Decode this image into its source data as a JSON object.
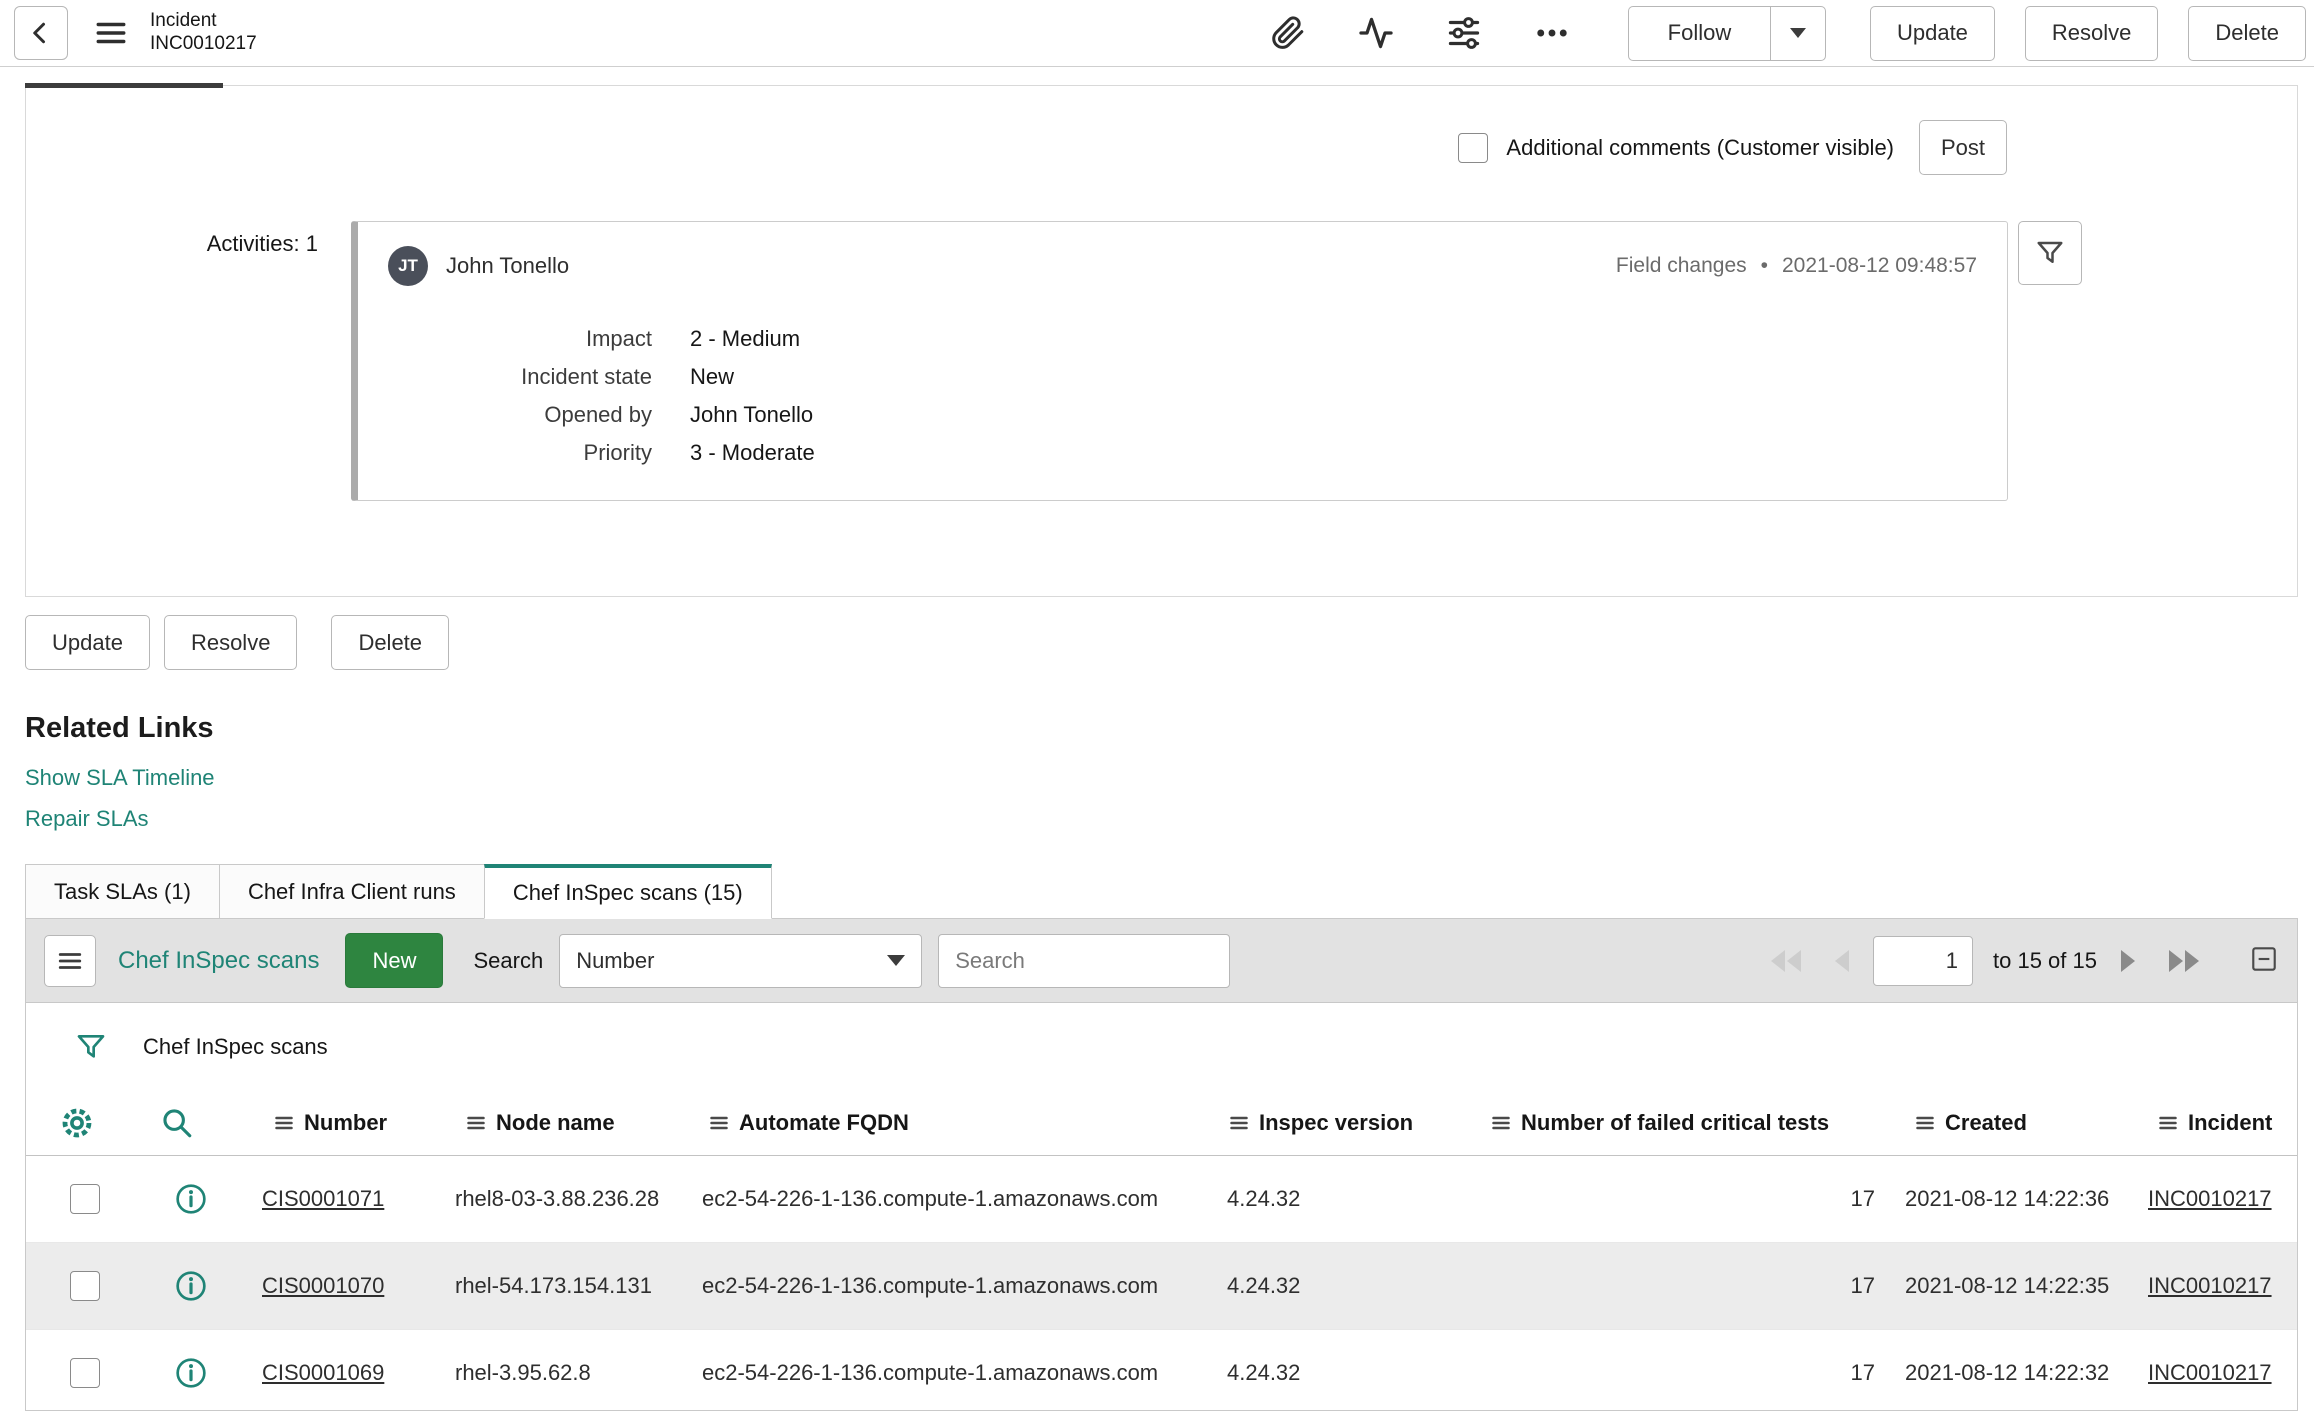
{
  "header": {
    "title_line1": "Incident",
    "title_line2": "INC0010217",
    "follow_label": "Follow",
    "update_label": "Update",
    "resolve_label": "Resolve",
    "delete_label": "Delete"
  },
  "comments": {
    "checkbox_label": "Additional comments (Customer visible)",
    "post_label": "Post"
  },
  "activity": {
    "section_label": "Activities: 1",
    "avatar_initials": "JT",
    "author": "John Tonello",
    "event_type": "Field changes",
    "separator": "•",
    "timestamp": "2021-08-12 09:48:57",
    "fields": [
      {
        "label": "Impact",
        "value": "2 - Medium"
      },
      {
        "label": "Incident state",
        "value": "New"
      },
      {
        "label": "Opened by",
        "value": "John Tonello"
      },
      {
        "label": "Priority",
        "value": "3 - Moderate"
      }
    ]
  },
  "form_actions": [
    "Update",
    "Resolve",
    "Delete"
  ],
  "related_links": {
    "title": "Related Links",
    "links": [
      "Show SLA Timeline",
      "Repair SLAs"
    ]
  },
  "tabs": [
    {
      "label": "Task SLAs (1)",
      "active": false
    },
    {
      "label": "Chef Infra Client runs",
      "active": false
    },
    {
      "label": "Chef InSpec scans (15)",
      "active": true
    }
  ],
  "list": {
    "title": "Chef InSpec scans",
    "new_label": "New",
    "search_label": "Search",
    "search_column": "Number",
    "search_placeholder": "Search",
    "page_value": "1",
    "page_range": "to 15 of 15",
    "breadcrumb": "Chef InSpec scans",
    "columns": [
      "Number",
      "Node name",
      "Automate FQDN",
      "Inspec version",
      "Number of failed critical tests",
      "Created",
      "Incident"
    ],
    "rows": [
      {
        "number": "CIS0001071",
        "node_name": "rhel8-03-3.88.236.28",
        "fqdn": "ec2-54-226-1-136.compute-1.amazonaws.com",
        "inspec_version": "4.24.32",
        "failed_tests": "17",
        "created": "2021-08-12 14:22:36",
        "incident": "INC0010217"
      },
      {
        "number": "CIS0001070",
        "node_name": "rhel-54.173.154.131",
        "fqdn": "ec2-54-226-1-136.compute-1.amazonaws.com",
        "inspec_version": "4.24.32",
        "failed_tests": "17",
        "created": "2021-08-12 14:22:35",
        "incident": "INC0010217"
      },
      {
        "number": "CIS0001069",
        "node_name": "rhel-3.95.62.8",
        "fqdn": "ec2-54-226-1-136.compute-1.amazonaws.com",
        "inspec_version": "4.24.32",
        "failed_tests": "17",
        "created": "2021-08-12 14:22:32",
        "incident": "INC0010217"
      }
    ]
  },
  "colors": {
    "teal_accent": "#1f8476",
    "green_button": "#2e8540",
    "toolbar_bg": "#e2e2e2",
    "row_alt_bg": "#ececec",
    "tab_active_border": "#1f8476"
  },
  "icons": {
    "back-icon": "chevron-left",
    "menu-icon": "hamburger",
    "attachment-icon": "paperclip",
    "activity-stream-icon": "pulse",
    "personalize-icon": "sliders",
    "more-options-icon": "ellipsis",
    "caret-down-icon": "triangle-down",
    "filter-icon": "funnel",
    "gear-icon": "gear",
    "search-icon": "magnifier",
    "info-icon": "circled-i",
    "first-page-icon": "double-triangle-left",
    "previous-page-icon": "triangle-left",
    "next-page-icon": "triangle-right",
    "last-page-icon": "double-triangle-right",
    "collapse-list-icon": "minus-box",
    "column-menu-icon": "hamburger-small"
  }
}
